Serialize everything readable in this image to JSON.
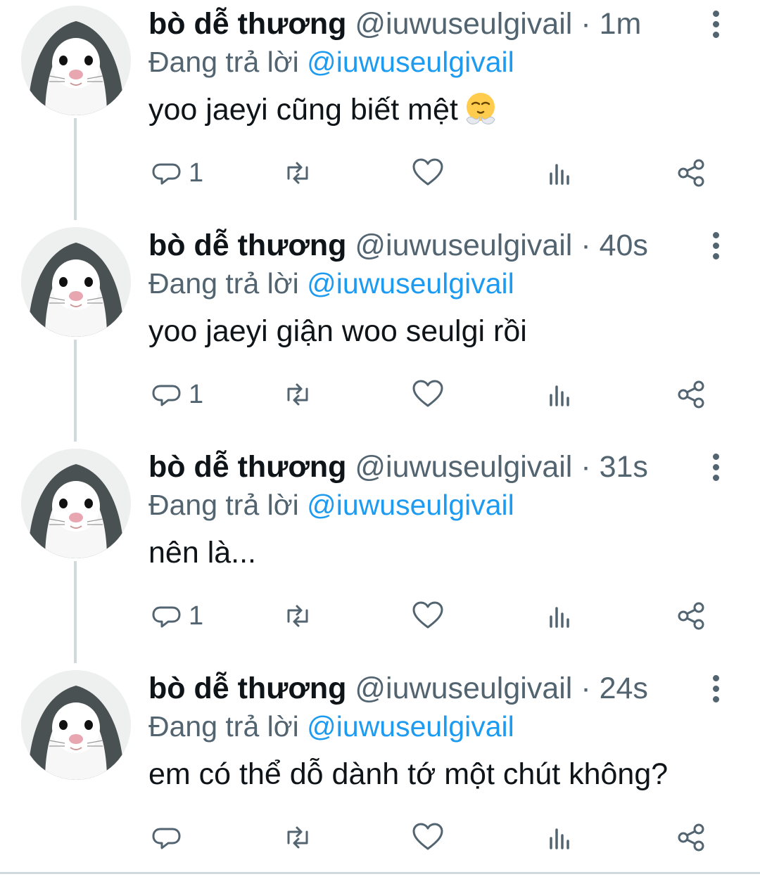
{
  "colors": {
    "text": "#0f1419",
    "secondary": "#536471",
    "accent": "#1d9bf0",
    "thread": "#cfd9de"
  },
  "icons": {
    "reply": "reply-bubble-icon",
    "retweet": "retweet-icon",
    "like": "heart-icon",
    "views": "views-bar-chart-icon",
    "share": "share-icon",
    "more": "more-vertical-icon"
  },
  "tweets": [
    {
      "name": "bò dễ thương",
      "handle": "@iuwuseulgivail",
      "separator": "·",
      "time": "1m",
      "reply_prefix": "Đang trả lời",
      "reply_to": "@iuwuseulgivail",
      "text": "yoo jaeyi cũng biết mệt",
      "emoji": "face-with-steam-from-nose",
      "reply_count": "1"
    },
    {
      "name": "bò dễ thương",
      "handle": "@iuwuseulgivail",
      "separator": "·",
      "time": "40s",
      "reply_prefix": "Đang trả lời",
      "reply_to": "@iuwuseulgivail",
      "text": "yoo jaeyi giận woo seulgi rồi",
      "reply_count": "1"
    },
    {
      "name": "bò dễ thương",
      "handle": "@iuwuseulgivail",
      "separator": "·",
      "time": "31s",
      "reply_prefix": "Đang trả lời",
      "reply_to": "@iuwuseulgivail",
      "text": "nên là...",
      "reply_count": "1"
    },
    {
      "name": "bò dễ thương",
      "handle": "@iuwuseulgivail",
      "separator": "·",
      "time": "24s",
      "reply_prefix": "Đang trả lời",
      "reply_to": "@iuwuseulgivail",
      "text": "em có thể dỗ dành tớ một chút không?",
      "reply_count": ""
    }
  ]
}
